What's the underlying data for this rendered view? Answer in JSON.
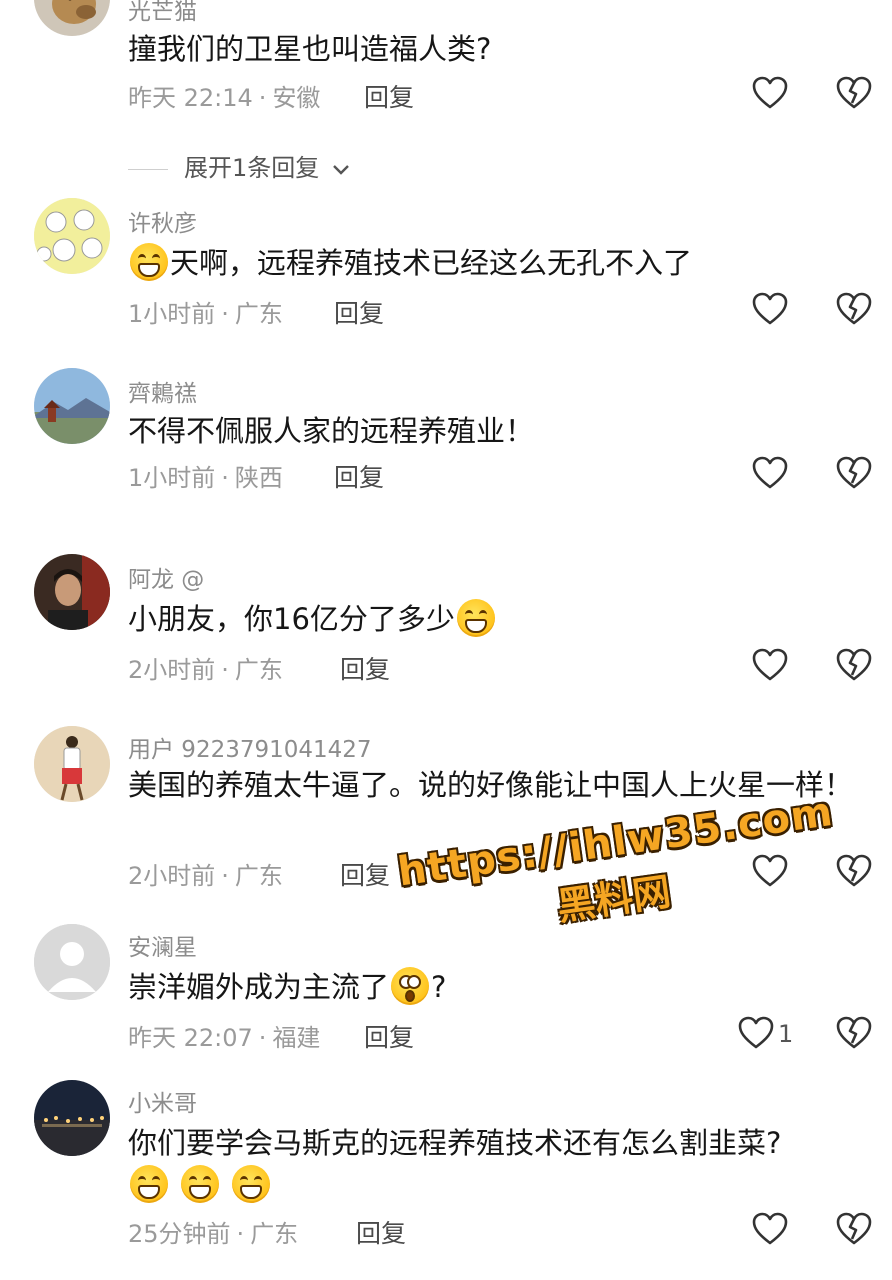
{
  "comments": [
    {
      "username": "光芒猫",
      "text_before": "撞我们的卫星也叫造福人类?",
      "text_after": "",
      "time": "昨天 22:14",
      "location": "安徽",
      "reply": "回复",
      "like_count": "",
      "avatar": "dog-avatar"
    },
    {
      "username": "许秋彦",
      "text_before": "",
      "emoji_prefix": "crying-laughing-emoji",
      "text_after": "天啊，远程养殖技术已经这么无孔不入了",
      "time": "1小时前",
      "location": "广东",
      "reply": "回复",
      "like_count": "",
      "avatar": "cartoon-avatar"
    },
    {
      "username": "齊鶫禚",
      "text_before": "不得不佩服人家的远程养殖业！",
      "text_after": "",
      "time": "1小时前",
      "location": "陕西",
      "reply": "回复",
      "like_count": "",
      "avatar": "pagoda-avatar"
    },
    {
      "username": "阿龙 @",
      "text_before": "小朋友，你16亿分了多少",
      "emoji_suffix": "grinning-sweat-emoji",
      "text_after": "",
      "time": "2小时前",
      "location": "广东",
      "reply": "回复",
      "like_count": "",
      "avatar": "selfie-avatar"
    },
    {
      "username": "用户 9223791041427",
      "text_before": "美国的养殖太牛逼了。说的好像能让中国人上火星一样！",
      "text_after": "",
      "time": "2小时前",
      "location": "广东",
      "reply": "回复",
      "like_count": "",
      "avatar": "figure-avatar"
    },
    {
      "username": "安澜星",
      "text_before": "崇洋媚外成为主流了",
      "emoji_suffix": "surprised-emoji",
      "text_after": "?",
      "time": "昨天 22:07",
      "location": "福建",
      "reply": "回复",
      "like_count": "1",
      "avatar": "default-avatar"
    },
    {
      "username": "小米哥",
      "text_before": "你们要学会马斯克的远程养殖技术还有怎么割韭菜?",
      "emoji_line": [
        "grinning-emoji",
        "grinning-emoji",
        "grinning-emoji"
      ],
      "text_after": "",
      "time": "25分钟前",
      "location": "广东",
      "reply": "回复",
      "like_count": "",
      "avatar": "night-city-avatar"
    }
  ],
  "expand_replies": "展开1条回复",
  "watermark": {
    "url": "https://ihlw35.com",
    "name": "黑料网"
  },
  "colors": {
    "username": "#8c8c8c",
    "meta": "#9a9a9a",
    "text": "#161616",
    "watermark": "#f5a623"
  }
}
